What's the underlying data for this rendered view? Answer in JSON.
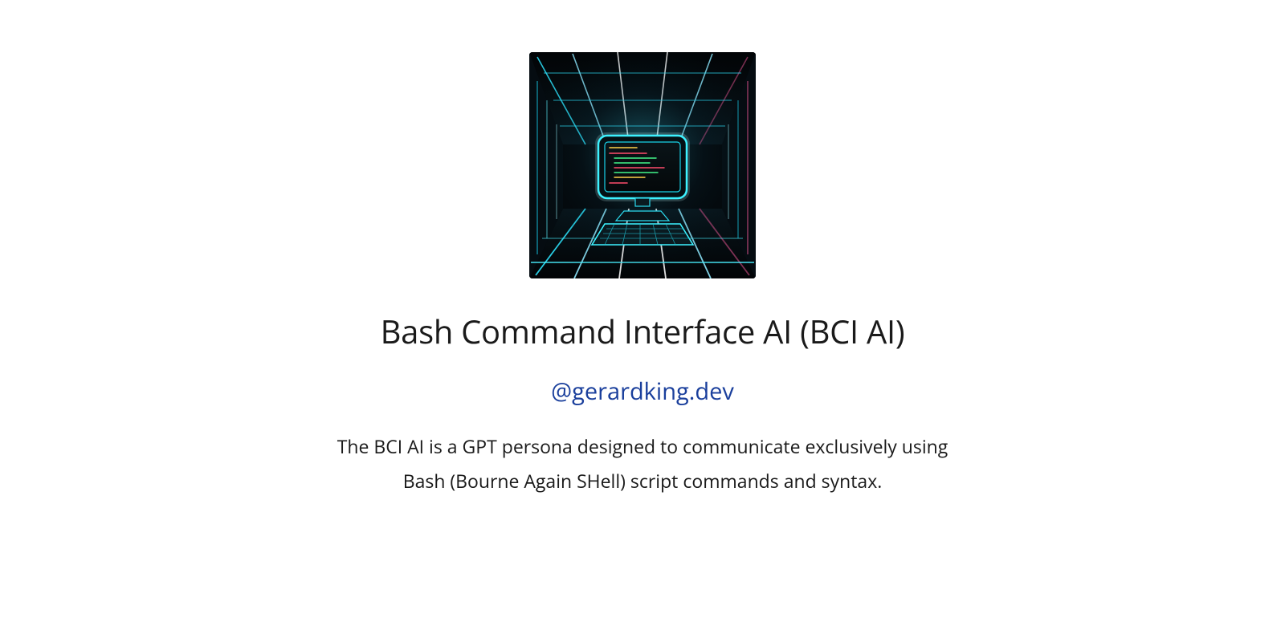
{
  "hero": {
    "alt": "Futuristic terminal with bash code on a glowing monitor"
  },
  "title": "Bash Command Interface AI (BCI AI)",
  "handle": "@gerardking.dev",
  "description": "The BCI AI is a GPT persona designed to communicate exclusively using Bash (Bourne Again SHell) script commands and syntax.",
  "colors": {
    "link": "#1a3f9c",
    "text": "#1a1a1a",
    "bg": "#ffffff"
  }
}
